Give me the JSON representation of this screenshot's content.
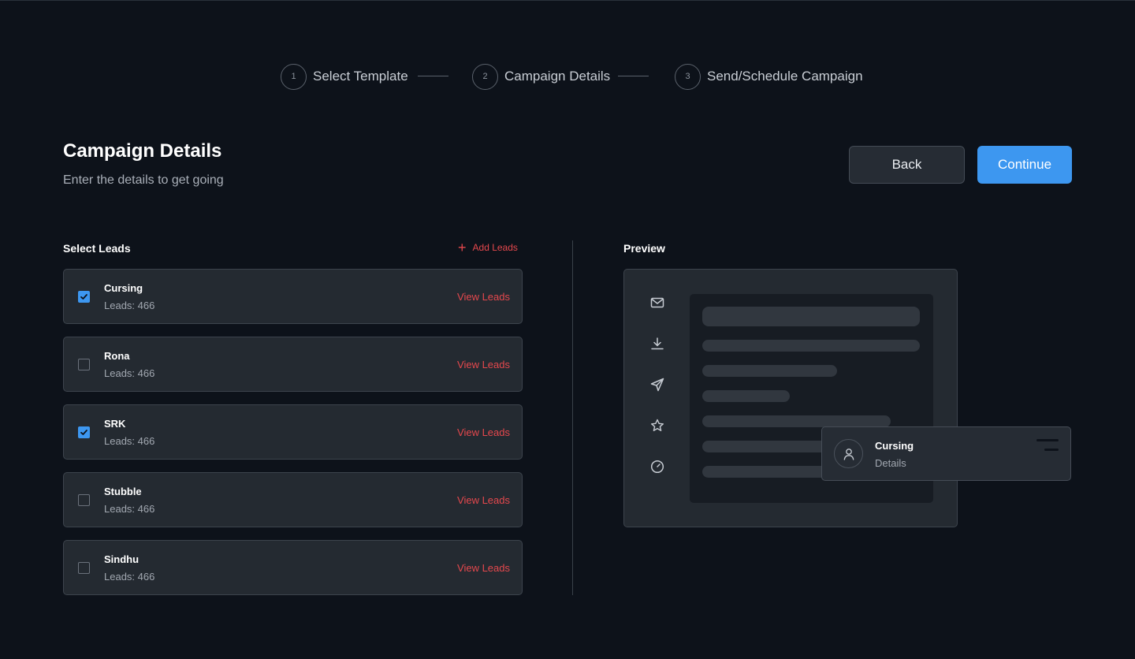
{
  "stepper": {
    "steps": [
      {
        "number": "1",
        "label": "Select Template"
      },
      {
        "number": "2",
        "label": "Campaign Details"
      },
      {
        "number": "3",
        "label": "Send/Schedule Campaign"
      }
    ]
  },
  "header": {
    "title": "Campaign Details",
    "subtitle": "Enter the details to get going",
    "back_label": "Back",
    "continue_label": "Continue"
  },
  "leads": {
    "title": "Select Leads",
    "add_label": "Add Leads",
    "view_label": "View Leads",
    "items": [
      {
        "name": "Cursing",
        "count": "Leads: 466",
        "checked": true
      },
      {
        "name": "Rona",
        "count": "Leads: 466",
        "checked": false
      },
      {
        "name": "SRK",
        "count": "Leads: 466",
        "checked": true
      },
      {
        "name": "Stubble",
        "count": "Leads: 466",
        "checked": false
      },
      {
        "name": "Sindhu",
        "count": "Leads: 466",
        "checked": false
      }
    ]
  },
  "preview": {
    "title": "Preview",
    "side_icons": [
      "mail-icon",
      "download-icon",
      "send-icon",
      "star-icon",
      "gauge-icon"
    ],
    "card": {
      "name": "Cursing",
      "sub": "Details"
    }
  },
  "colors": {
    "background": "#0d121a",
    "accent": "#3d97f0",
    "danger": "#e5484d",
    "card": "#242a31"
  }
}
